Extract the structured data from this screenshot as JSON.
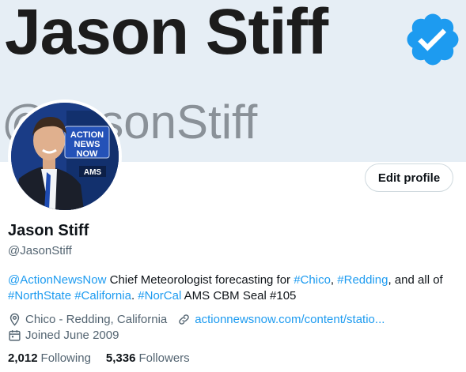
{
  "banner": {
    "name_text": "Jason Stiff",
    "handle_text": "@JasonStiff"
  },
  "avatar": {
    "sign_line1": "ACTION",
    "sign_line2": "NEWS",
    "sign_line3": "NOW",
    "sign_ams": "AMS"
  },
  "edit_profile_label": "Edit profile",
  "profile": {
    "display_name": "Jason Stiff",
    "username": "@JasonStiff",
    "bio": {
      "mention": "@ActionNewsNow",
      "text1": " Chief Meteorologist forecasting for ",
      "tag_chico": "#Chico",
      "sep1": ", ",
      "tag_redding": "#Redding",
      "text2": ", and all of ",
      "tag_northstate": "#NorthState",
      "sp1": " ",
      "tag_california": "#California",
      "dot": ". ",
      "tag_norcal": "#NorCal",
      "text3": " AMS CBM Seal #105"
    },
    "location": "Chico - Redding, California",
    "website": "actionnewsnow.com/content/statio...",
    "joined": "Joined June 2009",
    "following_count": "2,012",
    "following_label": "Following",
    "followers_count": "5,336",
    "followers_label": "Followers"
  },
  "colors": {
    "accent": "#1d9bf0",
    "verified": "#1d9bf0",
    "secondary_text": "#536471"
  },
  "icons": {
    "location": "location-pin-icon",
    "link": "link-icon",
    "calendar": "calendar-icon",
    "verified": "verified-badge-icon"
  }
}
